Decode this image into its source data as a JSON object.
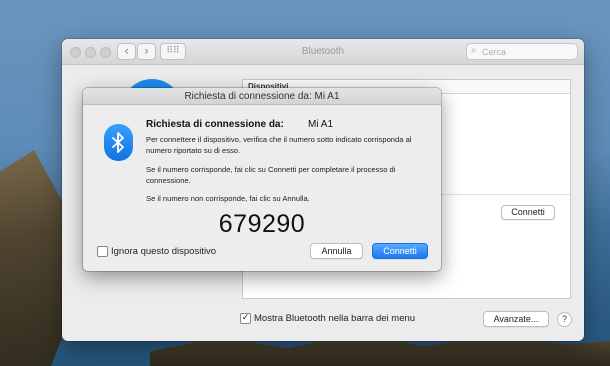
{
  "window": {
    "title": "Bluetooth",
    "search_placeholder": "Cerca",
    "back_icon": "chevron-left-icon",
    "forward_icon": "chevron-right-icon",
    "grid_icon": "grid-icon",
    "devices_header": "Dispositivi",
    "device_connect_label": "Connetti",
    "show_in_menubar_label": "Mostra Bluetooth nella barra dei menu",
    "show_in_menubar_checked": true,
    "advanced_label": "Avanzate...",
    "help_label": "?"
  },
  "dialog": {
    "title": "Richiesta di connessione da: Mi A1",
    "heading": "Richiesta di connessione da:",
    "device_name": "Mi A1",
    "paragraph1": "Per connettere il dispositivo, verifica che il numero sotto indicato corrisponda al numero riportato su di esso.",
    "paragraph2": "Se il numero corrisponde, fai clic su Connetti per completare il processo di connessione.",
    "paragraph3": "Se il numero non corrisponde, fai clic su Annulla.",
    "code": "679290",
    "ignore_label": "Ignora questo dispositivo",
    "ignore_checked": false,
    "cancel_label": "Annulla",
    "connect_label": "Connetti",
    "icon": "bluetooth-icon",
    "accent_color": "#1a7af0"
  }
}
